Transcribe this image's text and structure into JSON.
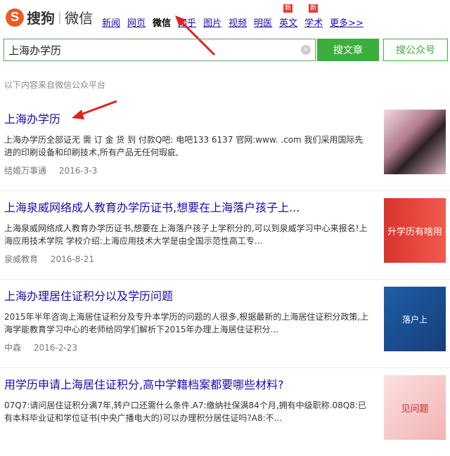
{
  "brand": {
    "mark": "S",
    "name": "搜狗",
    "sub": "微信"
  },
  "nav": [
    {
      "label": "新闻"
    },
    {
      "label": "网页"
    },
    {
      "label": "微信",
      "active": true
    },
    {
      "label": "知乎"
    },
    {
      "label": "图片"
    },
    {
      "label": "视频"
    },
    {
      "label": "明医"
    },
    {
      "label": "英文",
      "badge": "新"
    },
    {
      "label": "学术",
      "badge": "新"
    },
    {
      "label": "更多>>"
    }
  ],
  "search": {
    "query": "上海办学历",
    "primary_button": "搜文章",
    "secondary_button": "搜公众号"
  },
  "source_note": "以下内容来自微信公众平台",
  "results": [
    {
      "title": "上海办学历",
      "desc": "上海办学历全部证无 需 订 金 货 到 付款Q吧: 电吧133 6137 官网:www. .com 我们采用国际先进的印刷设备和印刷技术,所有产品无任何瑕疵,",
      "source": "结婚万事通",
      "date": "2016-3-3",
      "thumb_text": ""
    },
    {
      "title": "上海泉威网络成人教育办学历证书,想要在上海落户孩子上...",
      "desc": "上海泉威网络成人教育办学历证书,想要在上海落户孩子上学积分的,可以到泉威学习中心来报名!上海应用技术学院 学校介绍:上海应用技术大学是由全国示范性高工专...",
      "source": "泉威教育",
      "date": "2016-8-21",
      "thumb_text": "升学历有啥用"
    },
    {
      "title": "上海办理居住证积分以及学历问题",
      "desc": "2015年半年咨询上海居住证积分及专升本学历的问题的人很多,根据最新的上海居住证积分政策,上海学能教育学习中心的老师给同学们解析下2015年办理上海居住证积分...",
      "source": "中森",
      "date": "2016-2-23",
      "thumb_text": "落户上"
    },
    {
      "title": "用学历申请上海居住证积分,高中学籍档案都要哪些材料?",
      "desc": "07Q7:请问居住证积分满7年,转户口还需什么条件.A7:缴纳社保满84个月,拥有中级职称.08Q8:已有本科毕业证和学位证书(中央广播电大的)可以办理积分居住证吗?A8:不...",
      "source": "",
      "date": "",
      "thumb_text": "见问题"
    }
  ]
}
